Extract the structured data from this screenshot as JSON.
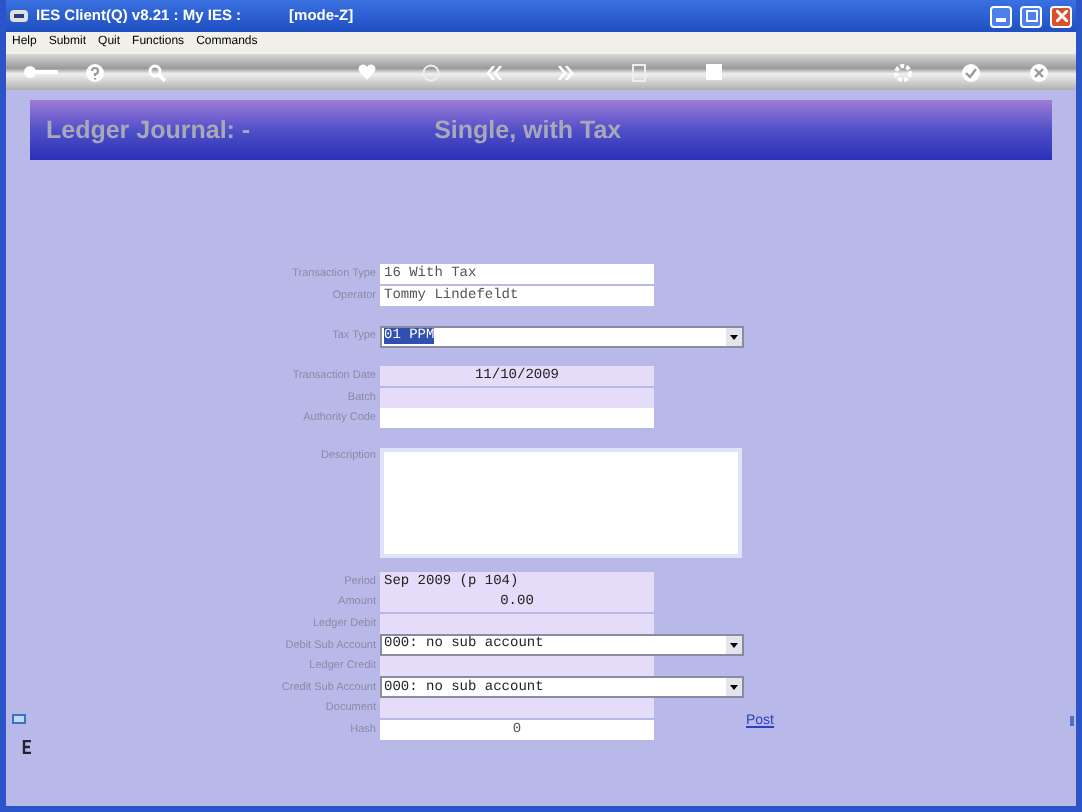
{
  "window": {
    "title": "IES Client(Q) v8.21 : My IES :",
    "mode": "[mode-Z]"
  },
  "menu": [
    "Help",
    "Submit",
    "Quit",
    "Functions",
    "Commands"
  ],
  "banner": {
    "title": "Ledger Journal: -",
    "subtitle": "Single, with Tax"
  },
  "form_groups": [
    [
      {
        "label": "Transaction Type",
        "kind": "text",
        "value": "16 With Tax",
        "centered": false
      },
      {
        "label": "Operator",
        "kind": "text",
        "value": "Tommy Lindefeldt",
        "centered": false
      }
    ],
    [
      {
        "label": "Tax Type",
        "kind": "select",
        "value": "01 PPM",
        "highlighted": true
      }
    ],
    [
      {
        "label": "Transaction Date",
        "kind": "shaded",
        "value": "11/10/2009",
        "centered": true
      },
      {
        "label": "Batch",
        "kind": "shaded"
      },
      {
        "label": "Authority Code",
        "kind": "text"
      }
    ],
    [
      {
        "label": "Description",
        "kind": "textarea"
      }
    ],
    [
      {
        "label": "Period",
        "kind": "shaded",
        "value": "Sep 2009 (p 104)",
        "centered": false
      },
      {
        "label": "Amount",
        "kind": "shaded",
        "value": "0.00",
        "centered": true
      },
      {
        "label": "Ledger Debit",
        "kind": "shaded"
      },
      {
        "label": "Debit Sub Account",
        "kind": "select",
        "value": "000: no sub account",
        "highlighted": false
      },
      {
        "label": "Ledger Credit",
        "kind": "shaded"
      },
      {
        "label": "Credit Sub Account",
        "kind": "select",
        "value": "000: no sub account",
        "highlighted": false
      },
      {
        "label": "Document",
        "kind": "shaded"
      },
      {
        "label": "Hash",
        "kind": "text",
        "value": "0",
        "centered": true
      }
    ]
  ],
  "post_link": "Post"
}
